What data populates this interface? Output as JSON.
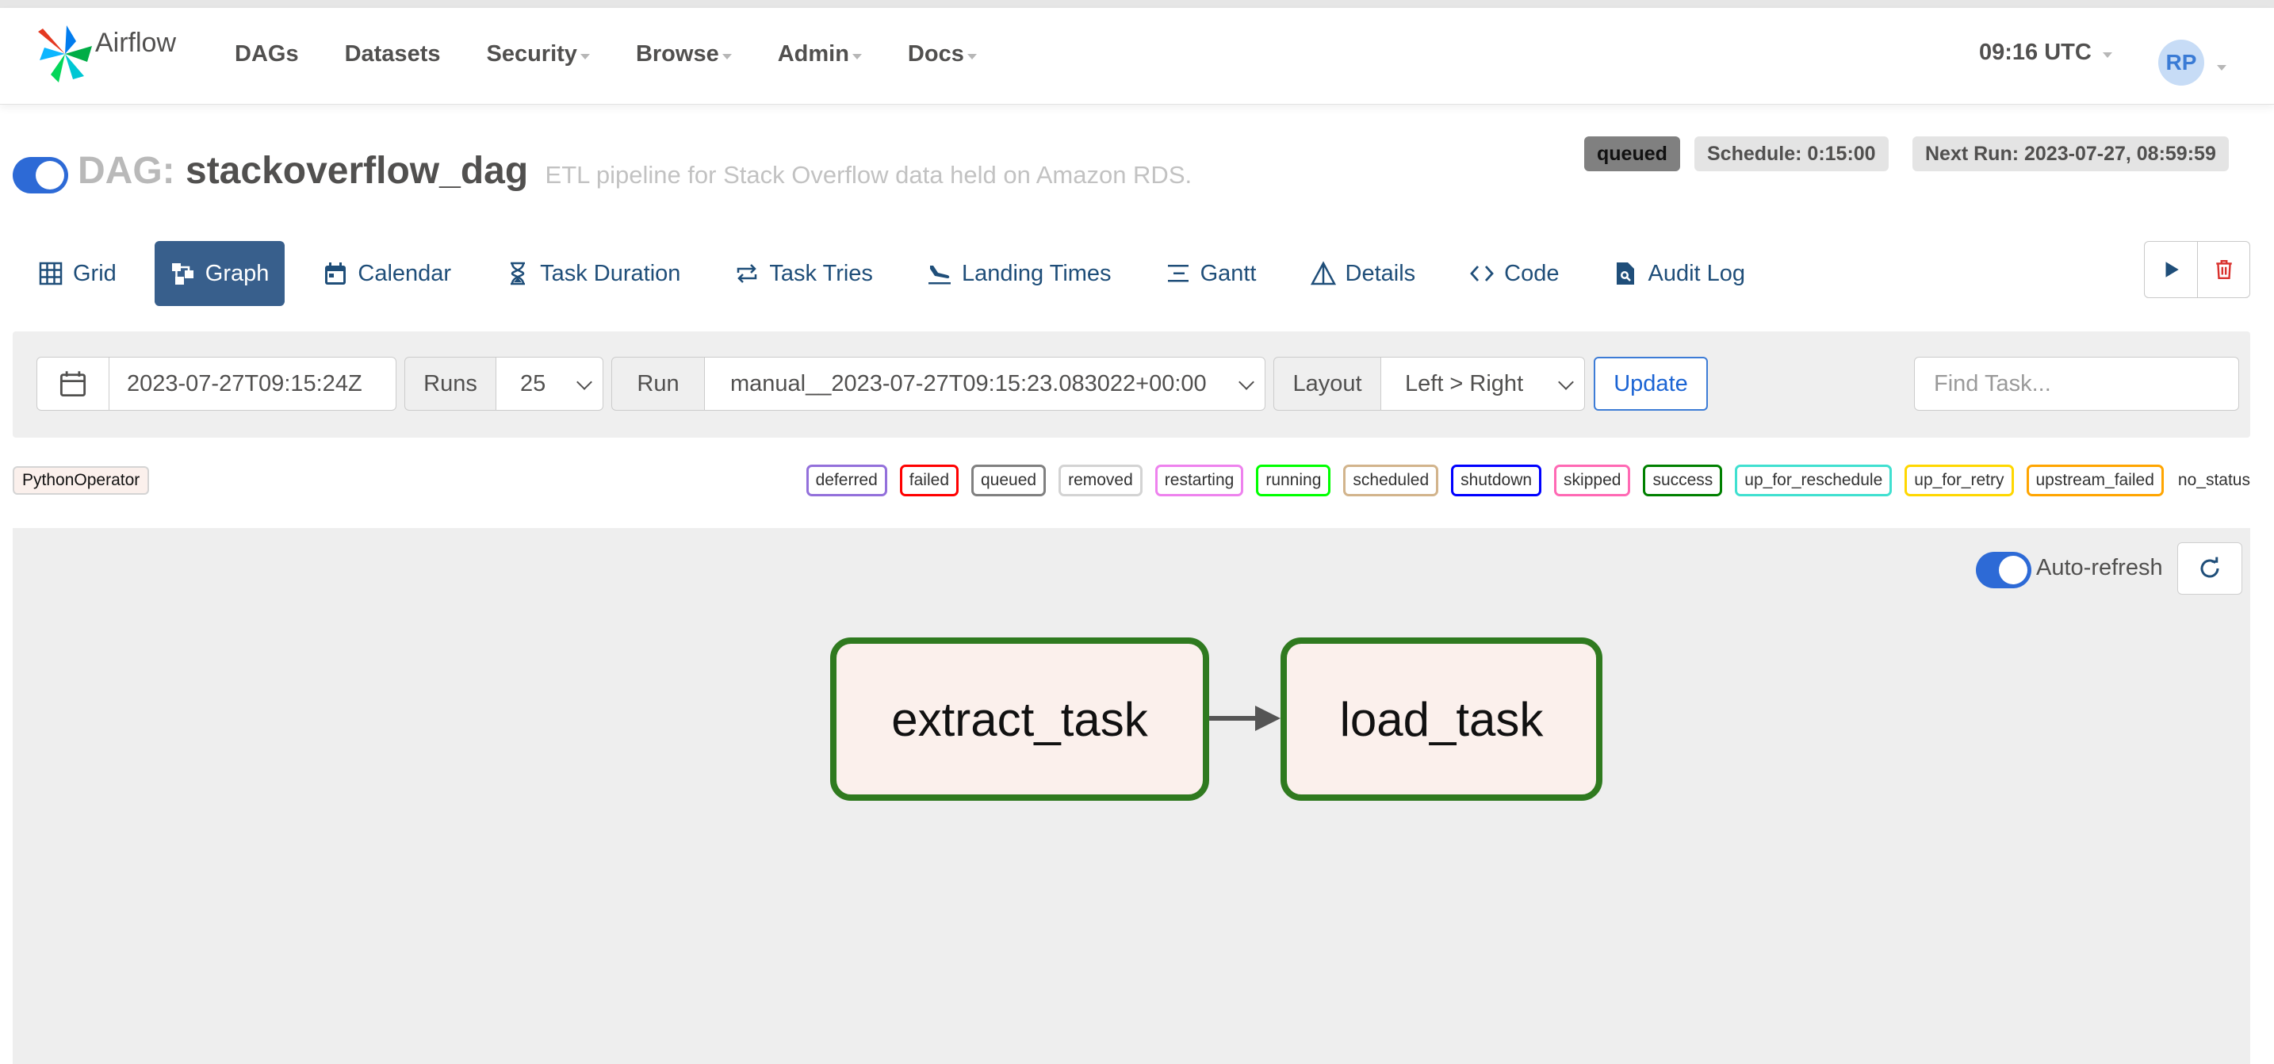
{
  "app": {
    "name": "Airflow"
  },
  "nav": {
    "items": [
      "DAGs",
      "Datasets",
      "Security",
      "Browse",
      "Admin",
      "Docs"
    ],
    "clock": "09:16 UTC",
    "avatar_initials": "RP"
  },
  "dag": {
    "prefix": "DAG:",
    "id": "stackoverflow_dag",
    "description": "ETL pipeline for Stack Overflow data held on Amazon RDS.",
    "paused": false,
    "state": "queued",
    "schedule": "Schedule: 0:15:00",
    "next_run": "Next Run: 2023-07-27, 08:59:59"
  },
  "tabs": {
    "grid": "Grid",
    "graph": "Graph",
    "calendar": "Calendar",
    "task_duration": "Task Duration",
    "task_tries": "Task Tries",
    "landing_times": "Landing Times",
    "gantt": "Gantt",
    "details": "Details",
    "code": "Code",
    "audit_log": "Audit Log",
    "active": "Graph"
  },
  "filter": {
    "base_date": "2023-07-27T09:15:24Z",
    "runs_label": "Runs",
    "runs_value": "25",
    "run_label": "Run",
    "run_value": "manual__2023-07-27T09:15:23.083022+00:00",
    "layout_label": "Layout",
    "layout_value": "Left > Right",
    "update_label": "Update",
    "find_placeholder": "Find Task..."
  },
  "legend": {
    "operator": {
      "name": "PythonOperator",
      "color": "#fbf0ec"
    },
    "states": [
      {
        "name": "deferred",
        "color": "#9370db"
      },
      {
        "name": "failed",
        "color": "#ff0000"
      },
      {
        "name": "queued",
        "color": "#808080"
      },
      {
        "name": "removed",
        "color": "#d3d3d3"
      },
      {
        "name": "restarting",
        "color": "#ee82ee"
      },
      {
        "name": "running",
        "color": "#00ff00"
      },
      {
        "name": "scheduled",
        "color": "#d2b48c"
      },
      {
        "name": "shutdown",
        "color": "#0000ff"
      },
      {
        "name": "skipped",
        "color": "#ff69b4"
      },
      {
        "name": "success",
        "color": "#008000"
      },
      {
        "name": "up_for_reschedule",
        "color": "#40e0d0"
      },
      {
        "name": "up_for_retry",
        "color": "#ffd700"
      },
      {
        "name": "upstream_failed",
        "color": "#ffa500"
      },
      {
        "name": "no_status",
        "color": ""
      }
    ]
  },
  "graph": {
    "auto_refresh_label": "Auto-refresh",
    "auto_refresh_on": true,
    "tasks": [
      {
        "id": "extract_task",
        "state": "success"
      },
      {
        "id": "load_task",
        "state": "success"
      }
    ],
    "edges": [
      {
        "from": "extract_task",
        "to": "load_task"
      }
    ]
  },
  "icons": {
    "grid": "grid-icon",
    "graph": "graph-icon",
    "calendar": "calendar-icon",
    "task_duration": "hourglass-icon",
    "task_tries": "repeat-icon",
    "landing_times": "plane-landing-icon",
    "gantt": "gantt-icon",
    "details": "triangle-icon",
    "code": "code-icon",
    "audit_log": "file-search-icon",
    "trigger": "play-icon",
    "delete": "trash-icon",
    "refresh": "refresh-icon"
  }
}
